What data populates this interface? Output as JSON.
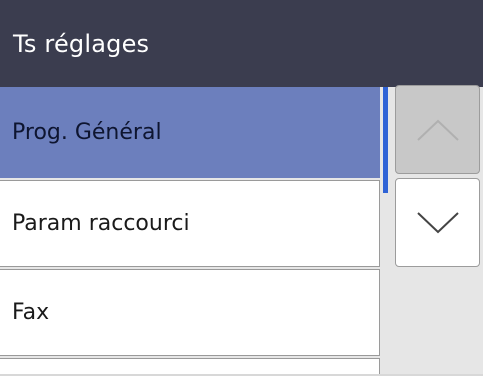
{
  "header": {
    "title": "Ts réglages"
  },
  "menu": {
    "items": [
      {
        "label": "Prog. Général",
        "selected": true
      },
      {
        "label": "Param raccourci",
        "selected": false
      },
      {
        "label": "Fax",
        "selected": false
      },
      {
        "label": "",
        "selected": false
      }
    ]
  },
  "scroll": {
    "up_icon": "chevron-up-icon",
    "down_icon": "chevron-down-icon",
    "up_enabled": false,
    "down_enabled": true
  },
  "colors": {
    "header_bg": "#3b3d4f",
    "selected_bg": "#6c7fbd",
    "scroll_thumb": "#2f63d6"
  }
}
